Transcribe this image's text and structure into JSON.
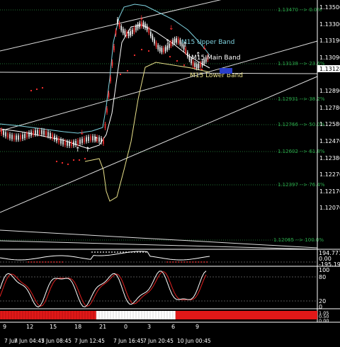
{
  "price_axis": {
    "labels": [
      "1.13500",
      "1.13300",
      "1.13190",
      "1.13090",
      "1.12890",
      "1.12780",
      "1.12580",
      "1.12470",
      "1.12380",
      "1.12270",
      "1.12170",
      "1.12070"
    ],
    "current_price": "1.13128"
  },
  "fibo_levels": [
    {
      "label": "1.13470 --> 0.0%"
    },
    {
      "label": "1.13138 --> 23.6%"
    },
    {
      "label": "1.12931 --> 38.2%"
    },
    {
      "label": "1.12766 --> 50.0%"
    },
    {
      "label": "1.12602 --> 61.8%"
    },
    {
      "label": "1.12397 --> 76.4%"
    },
    {
      "label": "1.12065 --> 100.0%"
    }
  ],
  "bands": {
    "upper": "M15 Upper Band",
    "main": "M15 Main Band",
    "lower": "M15 Lower Band"
  },
  "colors": {
    "upper_band": "#7fd3e0",
    "main_band": "#ffffff",
    "lower_band": "#e8e08a",
    "fib": "#2aa84a",
    "candle_red": "#ff3030",
    "accent_red": "#ff3030",
    "stoch_white": "#ffffff",
    "stoch_red": "#e02020"
  },
  "cci": {
    "labels": [
      "194.7711",
      "0.00",
      "-195.1929"
    ]
  },
  "stoch": {
    "labels": [
      "100",
      "80",
      "20",
      "0"
    ]
  },
  "bottom_panel": {
    "labels": [
      "1.05",
      "0.50",
      "0.00"
    ]
  },
  "hour_ticks": [
    "9",
    "12",
    "15",
    "18",
    "21",
    "0",
    "3",
    "6",
    "9"
  ],
  "date_ticks": [
    "7 Jun",
    "7 Jun 04:45",
    "7 Jun 08:45",
    "7 Jun 12:45",
    "7 Jun 16:45",
    "7 Jun 20:45",
    "10 Jun 00:45"
  ]
}
